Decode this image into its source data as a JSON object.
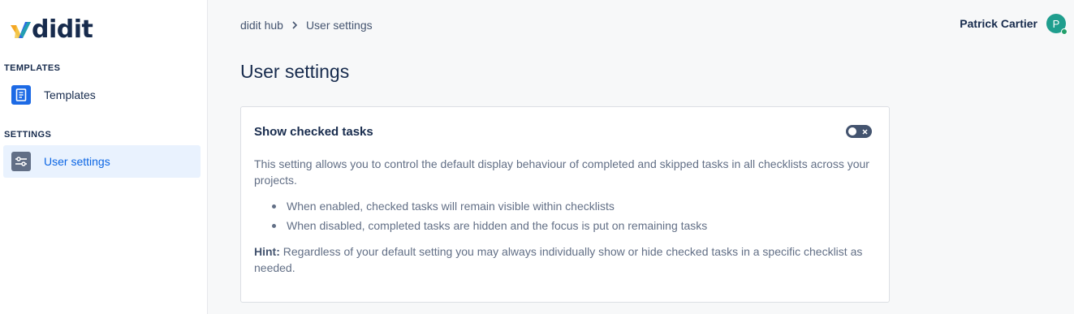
{
  "app": {
    "logo_text": "didit",
    "brand_colors": {
      "orange": "#f5a623",
      "blue": "#2d6be4",
      "teal": "#1fb59c"
    }
  },
  "sidebar": {
    "sections": [
      {
        "title": "TEMPLATES",
        "items": [
          {
            "label": "Templates",
            "icon": "document-icon",
            "active": false
          }
        ]
      },
      {
        "title": "SETTINGS",
        "items": [
          {
            "label": "User settings",
            "icon": "sliders-icon",
            "active": true
          }
        ]
      }
    ]
  },
  "breadcrumb": [
    "didit hub",
    "User settings"
  ],
  "user": {
    "name": "Patrick Cartier",
    "avatar_initial": "P",
    "status": "online"
  },
  "page": {
    "title": "User settings"
  },
  "setting": {
    "title": "Show checked tasks",
    "toggle_enabled": false,
    "description": "This setting allows you to control the default display behaviour of completed and skipped tasks in all checklists across your projects.",
    "bullets": [
      "When enabled, checked tasks will remain visible within checklists",
      "When disabled, completed tasks are hidden and the focus is put on remaining tasks"
    ],
    "hint_label": "Hint:",
    "hint_text": " Regardless of your default setting you may always individually show or hide checked tasks in a specific checklist as needed."
  }
}
